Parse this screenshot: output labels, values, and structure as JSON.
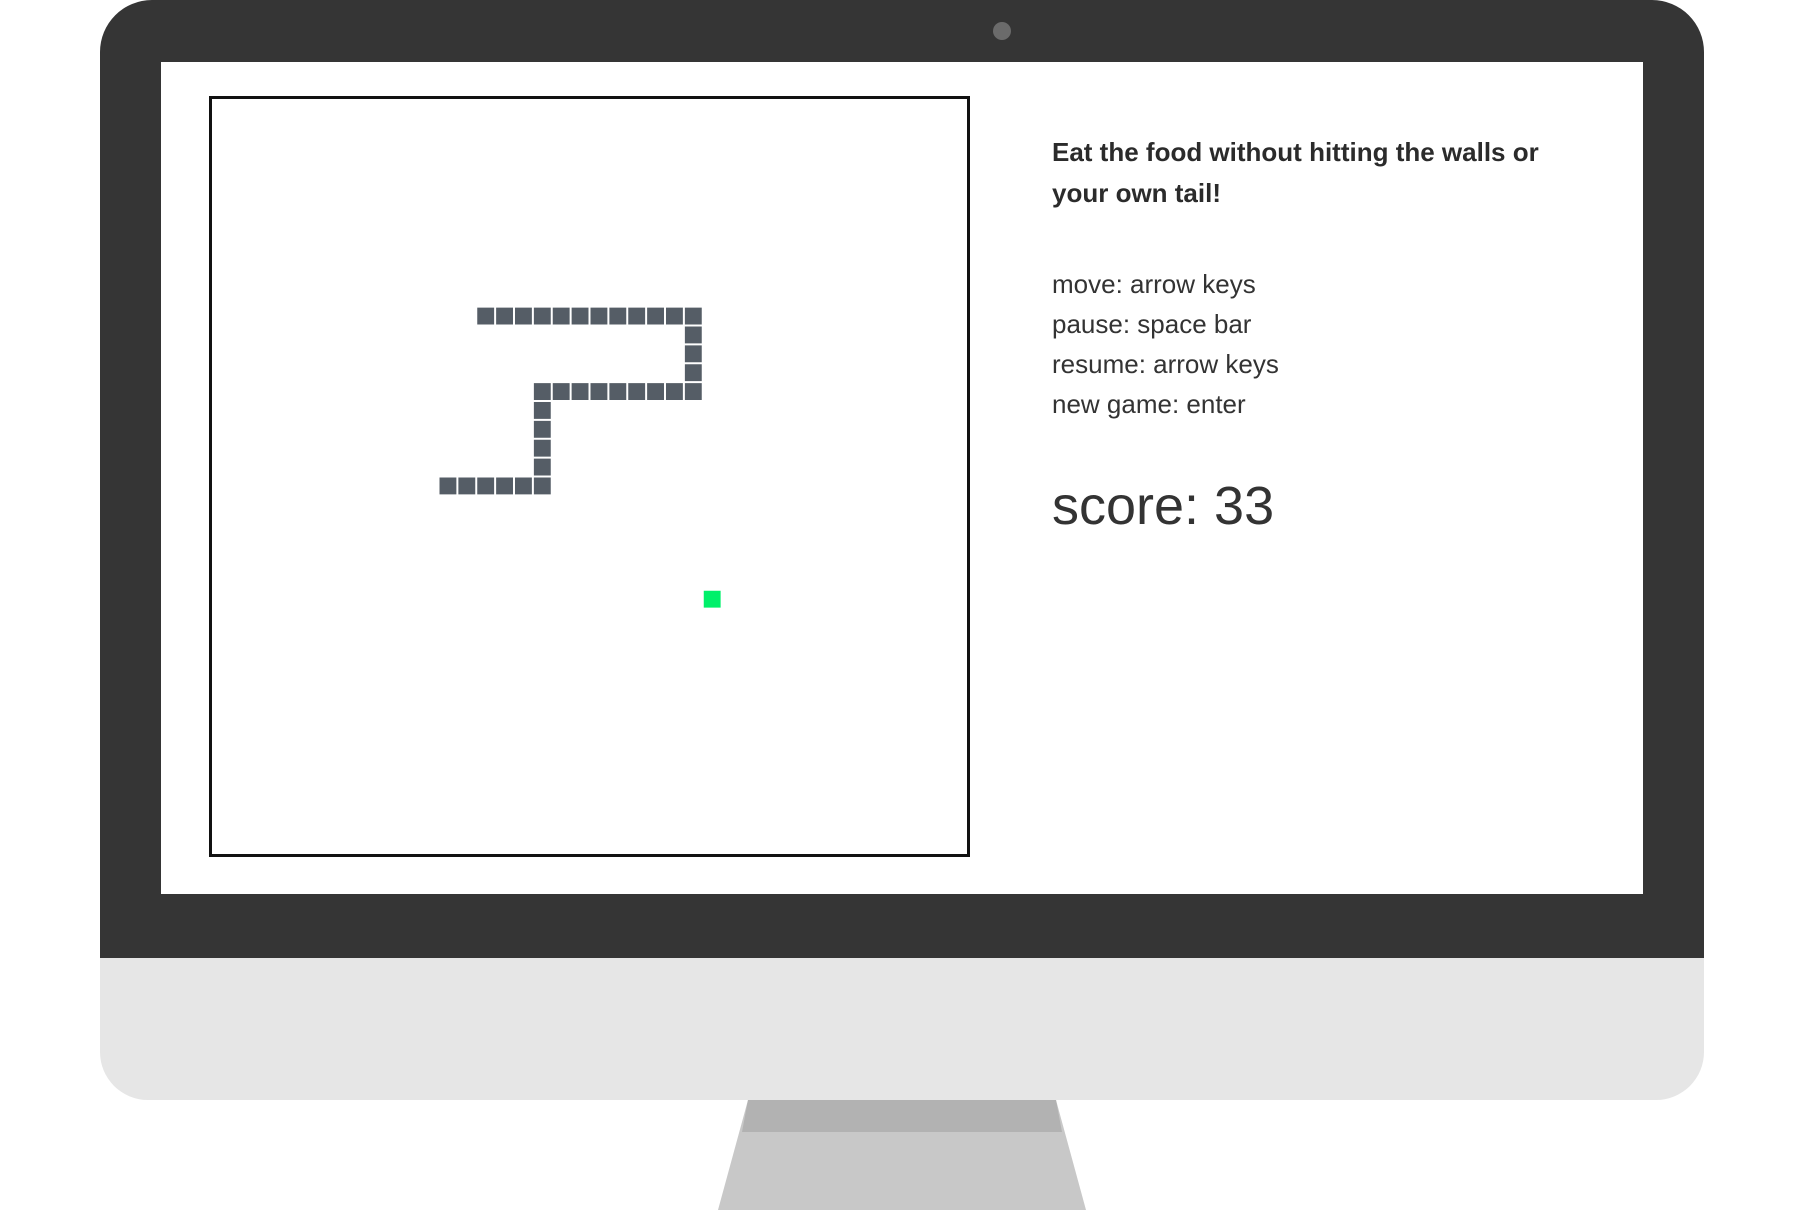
{
  "colors": {
    "bezel": "#353535",
    "chin": "#e6e6e6",
    "stand": "#c8c8c8",
    "stand_shadow": "#b2b2b2",
    "screen": "#ffffff",
    "board_border": "#111111",
    "snake": "#555d66",
    "food": "#00f06a"
  },
  "info": {
    "headline": "Eat the food without hitting the walls or your own tail!",
    "controls": [
      "move: arrow keys",
      "pause: space bar",
      "resume: arrow keys",
      "new game: enter"
    ],
    "score_label": "score: 33"
  },
  "game": {
    "grid_size": 40,
    "snake": [
      [
        12,
        20
      ],
      [
        13,
        20
      ],
      [
        14,
        20
      ],
      [
        15,
        20
      ],
      [
        16,
        20
      ],
      [
        17,
        20
      ],
      [
        17,
        19
      ],
      [
        17,
        18
      ],
      [
        17,
        17
      ],
      [
        17,
        16
      ],
      [
        17,
        15
      ],
      [
        18,
        15
      ],
      [
        19,
        15
      ],
      [
        20,
        15
      ],
      [
        21,
        15
      ],
      [
        22,
        15
      ],
      [
        23,
        15
      ],
      [
        24,
        15
      ],
      [
        25,
        15
      ],
      [
        25,
        14
      ],
      [
        25,
        13
      ],
      [
        25,
        12
      ],
      [
        25,
        11
      ],
      [
        24,
        11
      ],
      [
        23,
        11
      ],
      [
        22,
        11
      ],
      [
        21,
        11
      ],
      [
        20,
        11
      ],
      [
        19,
        11
      ],
      [
        18,
        11
      ],
      [
        17,
        11
      ],
      [
        16,
        11
      ],
      [
        15,
        11
      ],
      [
        14,
        11
      ]
    ],
    "food": [
      26,
      26
    ]
  }
}
